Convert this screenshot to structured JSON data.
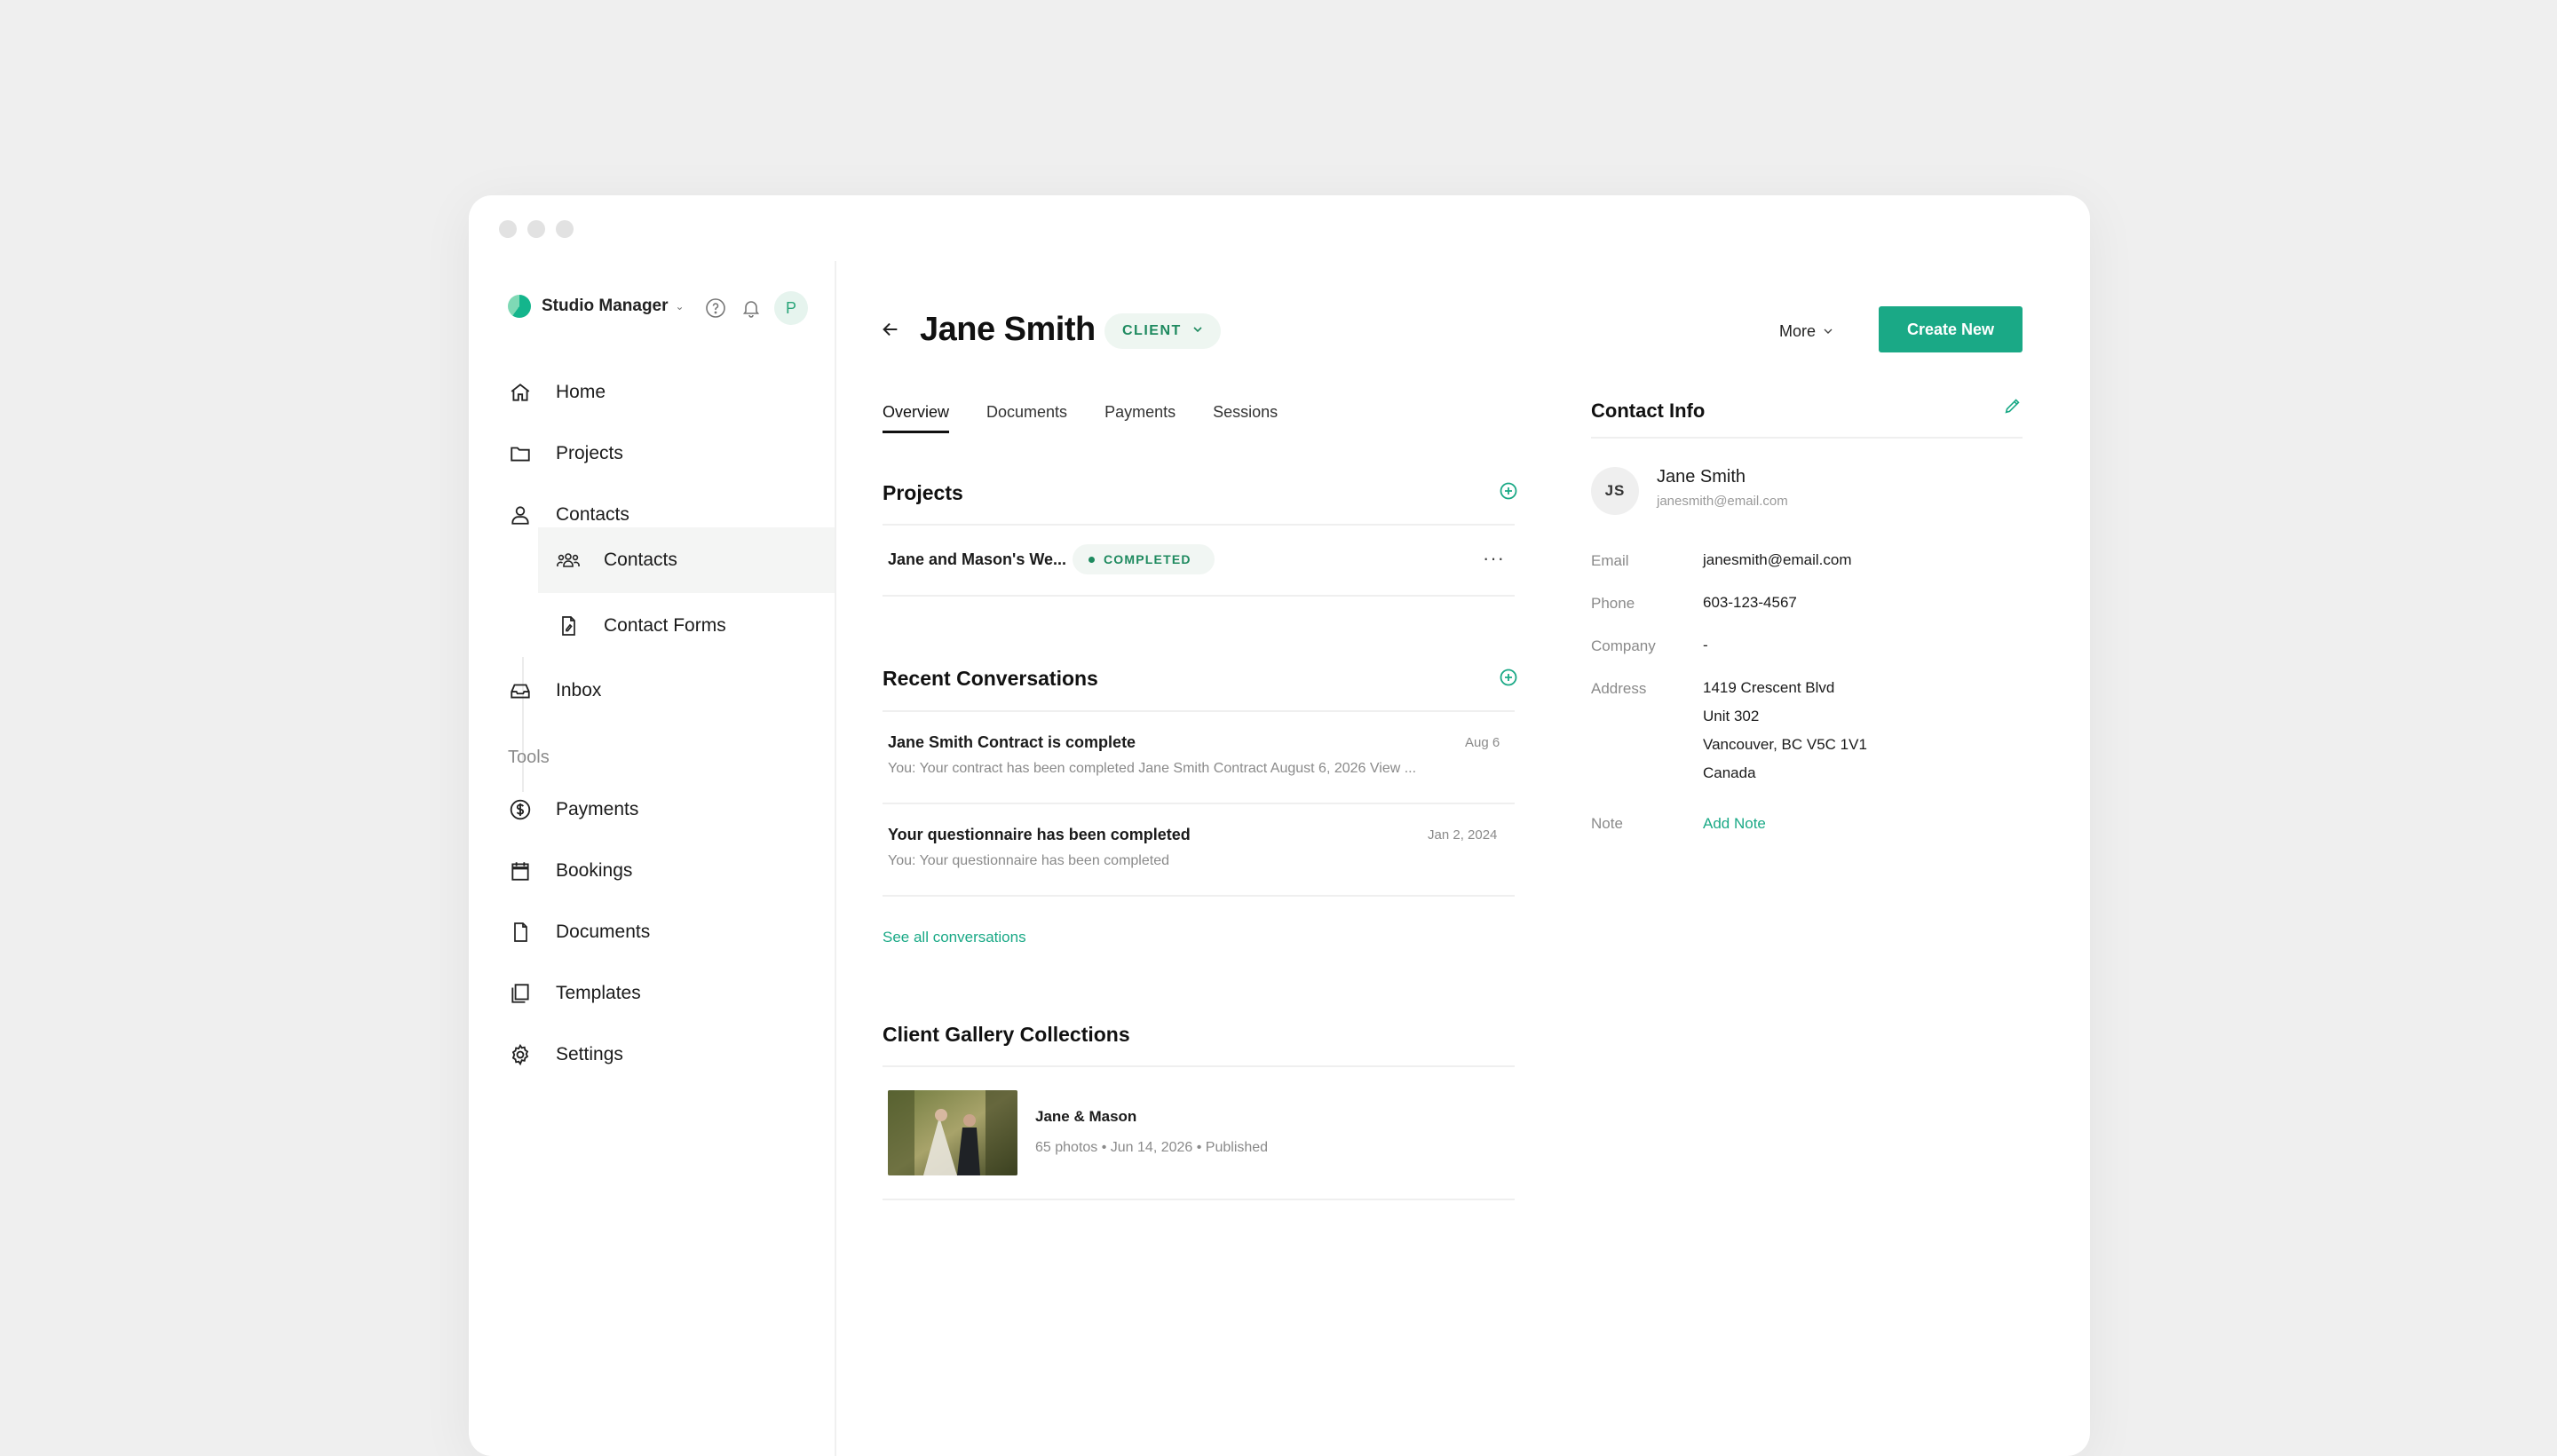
{
  "sidebar": {
    "brand": "Studio Manager",
    "avatar_initial": "P",
    "nav": {
      "home": "Home",
      "projects": "Projects",
      "contacts": "Contacts",
      "sub_contacts": "Contacts",
      "sub_contact_forms": "Contact Forms",
      "inbox": "Inbox"
    },
    "tools_label": "Tools",
    "tools": {
      "payments": "Payments",
      "bookings": "Bookings",
      "documents": "Documents",
      "templates": "Templates",
      "settings": "Settings"
    }
  },
  "header": {
    "title": "Jane Smith",
    "badge": "CLIENT",
    "more": "More",
    "create": "Create New"
  },
  "tabs": [
    "Overview",
    "Documents",
    "Payments",
    "Sessions"
  ],
  "projects": {
    "title": "Projects",
    "items": [
      {
        "name": "Jane and Mason's We...",
        "status": "COMPLETED"
      }
    ]
  },
  "conversations": {
    "title": "Recent Conversations",
    "items": [
      {
        "title": "Jane Smith Contract is complete",
        "preview": "You: Your contract has been completed Jane Smith Contract August 6, 2026 View ...",
        "date": "Aug 6"
      },
      {
        "title": "Your questionnaire has been completed",
        "preview": "You: Your questionnaire has been completed",
        "date": "Jan 2, 2024"
      }
    ],
    "see_all": "See all conversations"
  },
  "gallery": {
    "title": "Client Gallery Collections",
    "items": [
      {
        "name": "Jane & Mason",
        "meta": "65 photos • Jun 14, 2026 • Published"
      }
    ]
  },
  "contact": {
    "title": "Contact Info",
    "initials": "JS",
    "name": "Jane Smith",
    "email_sub": "janesmith@email.com",
    "labels": {
      "email": "Email",
      "phone": "Phone",
      "company": "Company",
      "address": "Address",
      "note": "Note"
    },
    "email": "janesmith@email.com",
    "phone": "603-123-4567",
    "company": "-",
    "address": [
      "1419 Crescent Blvd",
      "Unit 302",
      "Vancouver, BC V5C 1V1",
      "Canada"
    ],
    "add_note": "Add Note"
  },
  "colors": {
    "accent": "#1aa986",
    "badge_green": "#1e8a5f"
  }
}
